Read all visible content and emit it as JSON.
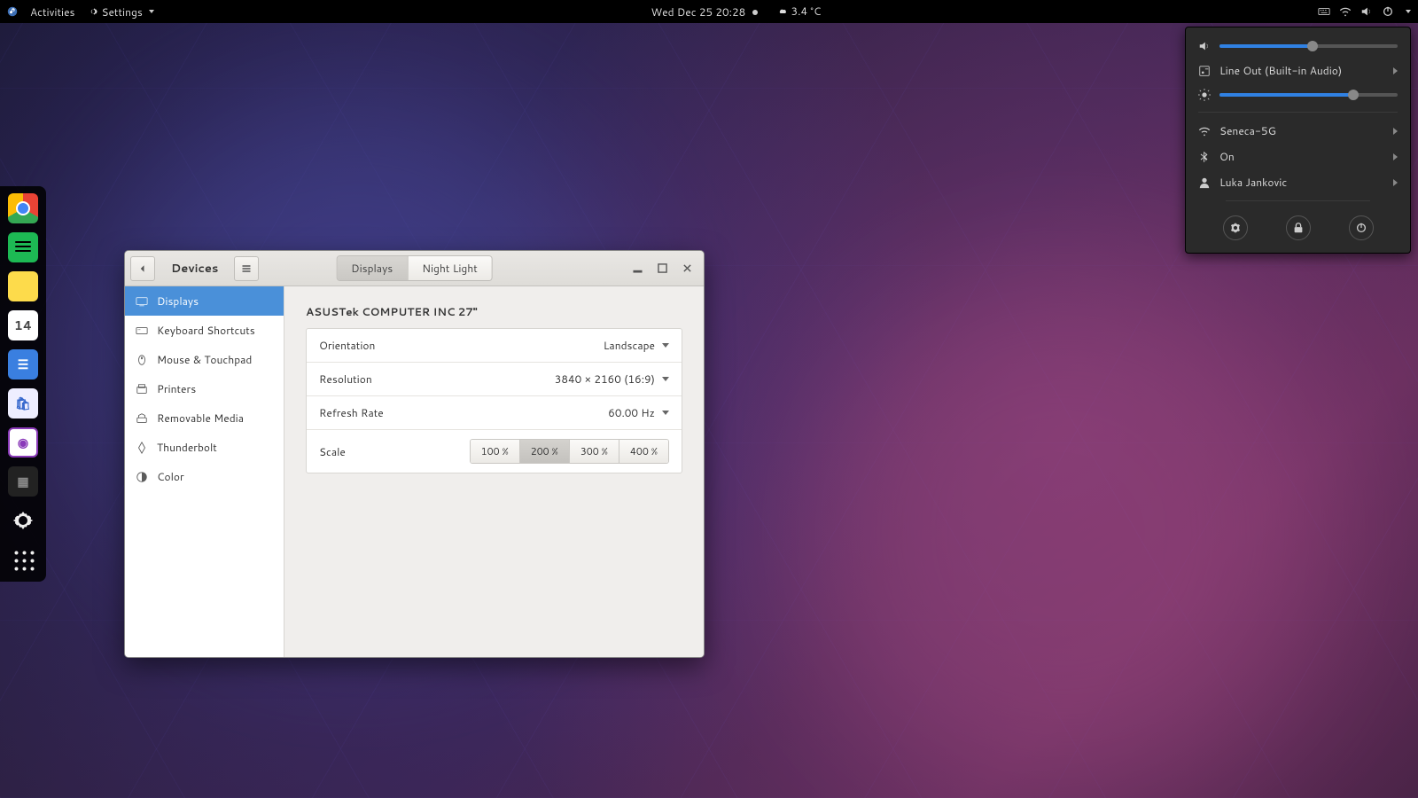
{
  "topbar": {
    "activities": "Activities",
    "settings": "Settings",
    "datetime": "Wed Dec 25  20:28",
    "temperature": "3.4 °C"
  },
  "sysmenu": {
    "volume_pct": 52,
    "brightness_pct": 75,
    "audio_out": "Line Out (Built-in Audio)",
    "wifi": "Seneca-5G",
    "bluetooth": "On",
    "user": "Luka Jankovic"
  },
  "dock": {
    "calendar_day": "14"
  },
  "window": {
    "back_title": "Devices",
    "tabs": {
      "displays": "Displays",
      "nightlight": "Night Light"
    },
    "sidebar": [
      "Displays",
      "Keyboard Shortcuts",
      "Mouse & Touchpad",
      "Printers",
      "Removable Media",
      "Thunderbolt",
      "Color"
    ],
    "display_name": "ASUSTek COMPUTER INC 27\"",
    "rows": {
      "orientation_label": "Orientation",
      "orientation_value": "Landscape",
      "resolution_label": "Resolution",
      "resolution_value": "3840 × 2160 (16:9)",
      "refresh_label": "Refresh Rate",
      "refresh_value": "60.00 Hz",
      "scale_label": "Scale"
    },
    "scale_options": [
      "100 %",
      "200 %",
      "300 %",
      "400 %"
    ],
    "scale_active": "200 %"
  }
}
